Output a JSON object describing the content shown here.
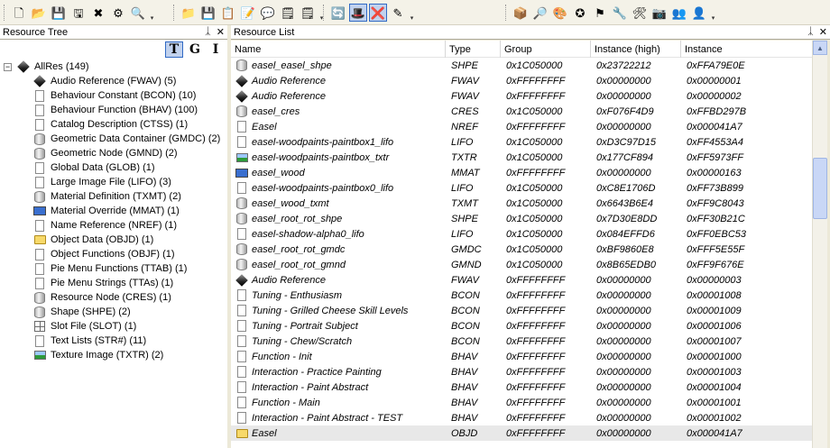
{
  "toolbar": {
    "groups": [
      {
        "id": "file",
        "buttons": [
          "new-icon",
          "open-icon",
          "save-icon",
          "save-as-icon",
          "close-icon",
          "plugin-icon",
          "settings-icon"
        ]
      },
      {
        "id": "edit",
        "buttons": [
          "open-folder-icon",
          "save-folder-icon",
          "refresh-icon",
          "cancel-icon",
          "comment-icon",
          "notes-icon",
          "notes2-icon"
        ]
      },
      {
        "id": "view",
        "buttons": [
          "sync-icon",
          "magic-hat-icon",
          "delete-icon",
          "eraser-icon"
        ]
      },
      {
        "id": "tools",
        "buttons": [
          "package-icon",
          "scan-icon",
          "palette-icon",
          "star-icon",
          "flag-icon",
          "tools-icon",
          "fix-icon",
          "camera-icon",
          "users-icon",
          "user-icon"
        ]
      }
    ],
    "glyphs": {
      "new-icon": "🗋",
      "open-icon": "📂",
      "save-icon": "💾",
      "save-as-icon": "🖫",
      "close-icon": "✖",
      "plugin-icon": "⚙",
      "settings-icon": "🔍",
      "open-folder-icon": "📁",
      "save-folder-icon": "💾",
      "refresh-icon": "📋",
      "cancel-icon": "📝",
      "comment-icon": "💬",
      "notes-icon": "🗒",
      "notes2-icon": "🗒",
      "sync-icon": "🔄",
      "magic-hat-icon": "🎩",
      "delete-icon": "❌",
      "eraser-icon": "✎",
      "package-icon": "📦",
      "scan-icon": "🔎",
      "palette-icon": "🎨",
      "star-icon": "✪",
      "flag-icon": "⚑",
      "tools-icon": "🔧",
      "fix-icon": "🛠",
      "camera-icon": "📷",
      "users-icon": "👥",
      "user-icon": "👤"
    }
  },
  "left_panel": {
    "title": "Resource Tree",
    "pin": "ᛣ",
    "close": "✕",
    "view_buttons": [
      "T",
      "G",
      "I"
    ]
  },
  "tree": {
    "root": {
      "label": "AllRes (149)",
      "expander": "−",
      "icon": "cube"
    },
    "items": [
      {
        "label": "Audio Reference (FWAV) (5)",
        "icon": "cube"
      },
      {
        "label": "Behaviour Constant (BCON) (10)",
        "icon": "sheet"
      },
      {
        "label": "Behaviour Function (BHAV) (100)",
        "icon": "sheet"
      },
      {
        "label": "Catalog Description (CTSS) (1)",
        "icon": "sheet"
      },
      {
        "label": "Geometric Data Container (GMDC) (2)",
        "icon": "cyl"
      },
      {
        "label": "Geometric Node (GMND) (2)",
        "icon": "cyl"
      },
      {
        "label": "Global Data (GLOB) (1)",
        "icon": "sheet"
      },
      {
        "label": "Large Image File (LIFO) (3)",
        "icon": "sheet"
      },
      {
        "label": "Material Definition (TXMT) (2)",
        "icon": "cyl"
      },
      {
        "label": "Material Override (MMAT) (1)",
        "icon": "mon"
      },
      {
        "label": "Name Reference (NREF) (1)",
        "icon": "sheet"
      },
      {
        "label": "Object Data (OBJD) (1)",
        "icon": "folder"
      },
      {
        "label": "Object Functions (OBJF) (1)",
        "icon": "sheet"
      },
      {
        "label": "Pie Menu Functions (TTAB) (1)",
        "icon": "sheet"
      },
      {
        "label": "Pie Menu Strings (TTAs) (1)",
        "icon": "sheet"
      },
      {
        "label": "Resource Node (CRES) (1)",
        "icon": "cyl"
      },
      {
        "label": "Shape (SHPE) (2)",
        "icon": "cyl"
      },
      {
        "label": "Slot File (SLOT) (1)",
        "icon": "grid"
      },
      {
        "label": "Text Lists (STR#) (11)",
        "icon": "sheet"
      },
      {
        "label": "Texture Image (TXTR) (2)",
        "icon": "img"
      }
    ]
  },
  "right_panel": {
    "title": "Resource List",
    "pin": "ᛣ",
    "close": "✕"
  },
  "table": {
    "columns": [
      "Name",
      "Type",
      "Group",
      "Instance (high)",
      "Instance"
    ],
    "rows": [
      {
        "icon": "cyl",
        "name": "easel_easel_shpe",
        "type": "SHPE",
        "group": "0x1C050000",
        "ihigh": "0x23722212",
        "inst": "0xFFA79E0E"
      },
      {
        "icon": "cube",
        "name": "Audio Reference",
        "type": "FWAV",
        "group": "0xFFFFFFFF",
        "ihigh": "0x00000000",
        "inst": "0x00000001"
      },
      {
        "icon": "cube",
        "name": "Audio Reference",
        "type": "FWAV",
        "group": "0xFFFFFFFF",
        "ihigh": "0x00000000",
        "inst": "0x00000002"
      },
      {
        "icon": "cyl",
        "name": "easel_cres",
        "type": "CRES",
        "group": "0x1C050000",
        "ihigh": "0xF076F4D9",
        "inst": "0xFFBD297B"
      },
      {
        "icon": "sheet",
        "name": "Easel",
        "type": "NREF",
        "group": "0xFFFFFFFF",
        "ihigh": "0x00000000",
        "inst": "0x000041A7"
      },
      {
        "icon": "sheet",
        "name": "easel-woodpaints-paintbox1_lifo",
        "type": "LIFO",
        "group": "0x1C050000",
        "ihigh": "0xD3C97D15",
        "inst": "0xFF4553A4"
      },
      {
        "icon": "img",
        "name": "easel-woodpaints-paintbox_txtr",
        "type": "TXTR",
        "group": "0x1C050000",
        "ihigh": "0x177CF894",
        "inst": "0xFF5973FF"
      },
      {
        "icon": "mon",
        "name": "easel_wood",
        "type": "MMAT",
        "group": "0xFFFFFFFF",
        "ihigh": "0x00000000",
        "inst": "0x00000163"
      },
      {
        "icon": "sheet",
        "name": "easel-woodpaints-paintbox0_lifo",
        "type": "LIFO",
        "group": "0x1C050000",
        "ihigh": "0xC8E1706D",
        "inst": "0xFF73B899"
      },
      {
        "icon": "cyl",
        "name": "easel_wood_txmt",
        "type": "TXMT",
        "group": "0x1C050000",
        "ihigh": "0x6643B6E4",
        "inst": "0xFF9C8043"
      },
      {
        "icon": "cyl",
        "name": "easel_root_rot_shpe",
        "type": "SHPE",
        "group": "0x1C050000",
        "ihigh": "0x7D30E8DD",
        "inst": "0xFF30B21C"
      },
      {
        "icon": "sheet",
        "name": "easel-shadow-alpha0_lifo",
        "type": "LIFO",
        "group": "0x1C050000",
        "ihigh": "0x084EFFD6",
        "inst": "0xFF0EBC53"
      },
      {
        "icon": "cyl",
        "name": "easel_root_rot_gmdc",
        "type": "GMDC",
        "group": "0x1C050000",
        "ihigh": "0xBF9860E8",
        "inst": "0xFFF5E55F"
      },
      {
        "icon": "cyl",
        "name": "easel_root_rot_gmnd",
        "type": "GMND",
        "group": "0x1C050000",
        "ihigh": "0x8B65EDB0",
        "inst": "0xFF9F676E"
      },
      {
        "icon": "cube",
        "name": "Audio Reference",
        "type": "FWAV",
        "group": "0xFFFFFFFF",
        "ihigh": "0x00000000",
        "inst": "0x00000003"
      },
      {
        "icon": "sheet",
        "name": "Tuning - Enthusiasm",
        "type": "BCON",
        "group": "0xFFFFFFFF",
        "ihigh": "0x00000000",
        "inst": "0x00001008"
      },
      {
        "icon": "sheet",
        "name": "Tuning - Grilled Cheese Skill Levels",
        "type": "BCON",
        "group": "0xFFFFFFFF",
        "ihigh": "0x00000000",
        "inst": "0x00001009"
      },
      {
        "icon": "sheet",
        "name": "Tuning - Portrait Subject",
        "type": "BCON",
        "group": "0xFFFFFFFF",
        "ihigh": "0x00000000",
        "inst": "0x00001006"
      },
      {
        "icon": "sheet",
        "name": "Tuning - Chew/Scratch",
        "type": "BCON",
        "group": "0xFFFFFFFF",
        "ihigh": "0x00000000",
        "inst": "0x00001007"
      },
      {
        "icon": "sheet",
        "name": "Function - Init",
        "type": "BHAV",
        "group": "0xFFFFFFFF",
        "ihigh": "0x00000000",
        "inst": "0x00001000"
      },
      {
        "icon": "sheet",
        "name": "Interaction - Practice Painting",
        "type": "BHAV",
        "group": "0xFFFFFFFF",
        "ihigh": "0x00000000",
        "inst": "0x00001003"
      },
      {
        "icon": "sheet",
        "name": "Interaction - Paint Abstract",
        "type": "BHAV",
        "group": "0xFFFFFFFF",
        "ihigh": "0x00000000",
        "inst": "0x00001004"
      },
      {
        "icon": "sheet",
        "name": "Function - Main",
        "type": "BHAV",
        "group": "0xFFFFFFFF",
        "ihigh": "0x00000000",
        "inst": "0x00001001"
      },
      {
        "icon": "sheet",
        "name": "Interaction - Paint Abstract - TEST",
        "type": "BHAV",
        "group": "0xFFFFFFFF",
        "ihigh": "0x00000000",
        "inst": "0x00001002"
      },
      {
        "icon": "folder",
        "name": "Easel",
        "type": "OBJD",
        "group": "0xFFFFFFFF",
        "ihigh": "0x00000000",
        "inst": "0x000041A7",
        "selected": true
      }
    ]
  },
  "scrollbar": {
    "up": "▲",
    "down": "▼"
  }
}
